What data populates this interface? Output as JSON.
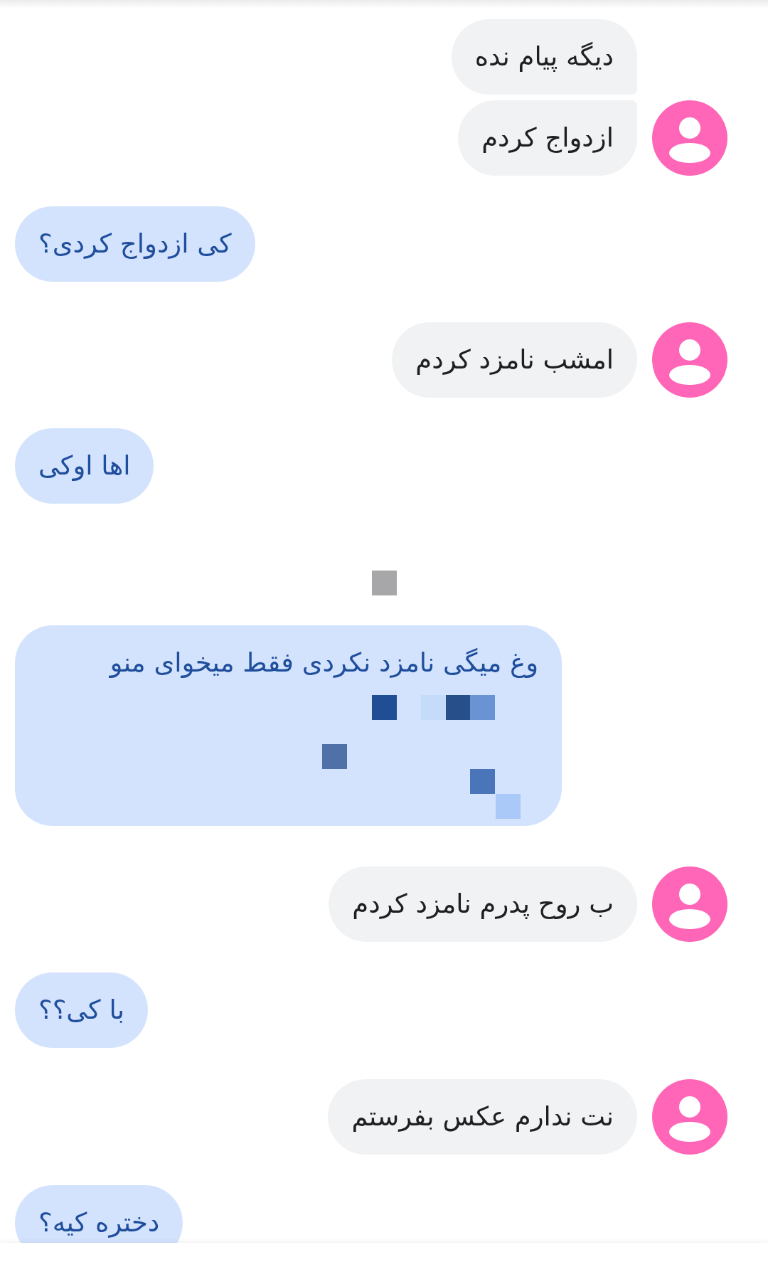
{
  "messages": [
    {
      "kind": "received",
      "text": "دیگه پیام نده",
      "avatar": false
    },
    {
      "kind": "received",
      "text": "ازدواج کردم",
      "avatar": true
    },
    {
      "kind": "sent",
      "text": "کی ازدواج کردی؟",
      "redacted": false
    },
    {
      "kind": "received",
      "text": "امشب نامزد کردم",
      "avatar": true
    },
    {
      "kind": "sent",
      "text": "اها اوکی",
      "redacted": false
    },
    {
      "kind": "censor_mark"
    },
    {
      "kind": "sent",
      "text": "وغ میگی نامزد نکردی فقط میخوای منو",
      "redacted": true
    },
    {
      "kind": "received",
      "text": "ب روح پدرم نامزد کردم",
      "avatar": true
    },
    {
      "kind": "sent",
      "text": "با کی؟؟",
      "redacted": false
    },
    {
      "kind": "received",
      "text": "نت ندارم عکس بفرستم",
      "avatar": true
    },
    {
      "kind": "sent",
      "text": "دختره کیه؟",
      "redacted": false
    }
  ]
}
